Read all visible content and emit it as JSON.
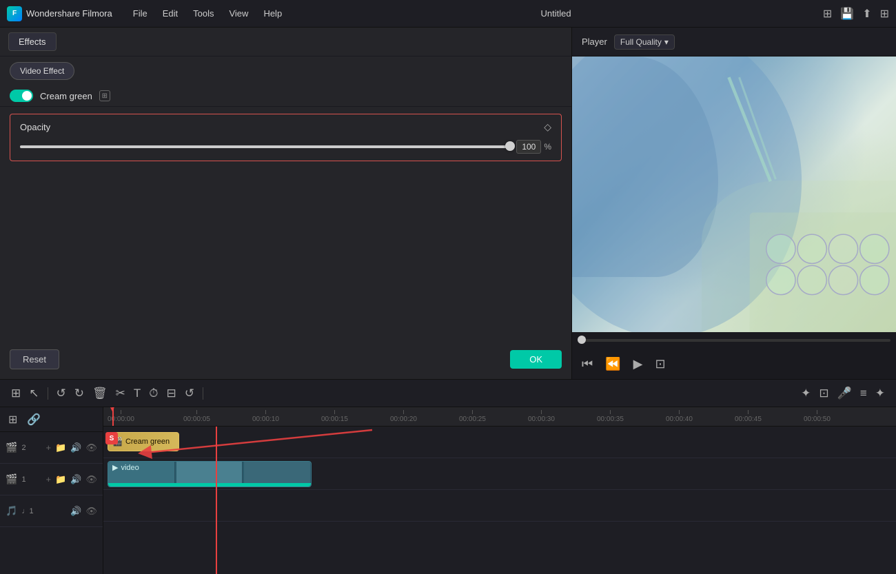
{
  "app": {
    "name": "Wondershare Filmora",
    "title": "Untitled"
  },
  "menu": {
    "items": [
      "File",
      "Edit",
      "Tools",
      "View",
      "Help"
    ]
  },
  "effects_panel": {
    "tab_label": "Effects",
    "video_effect_btn": "Video Effect",
    "toggle_label": "Cream green",
    "opacity_label": "Opacity",
    "opacity_value": "100",
    "percent": "%",
    "reset_btn": "Reset",
    "ok_btn": "OK"
  },
  "player": {
    "label": "Player",
    "quality_label": "Full Quality"
  },
  "timeline": {
    "tracks": [
      {
        "id": "track2",
        "type": "effect",
        "label": "2"
      },
      {
        "id": "track1",
        "type": "video",
        "label": "1"
      },
      {
        "id": "trackA1",
        "type": "audio",
        "label": "♩1"
      }
    ],
    "time_marks": [
      "00:00:00",
      "00:00:05",
      "00:00:10",
      "00:00:15",
      "00:00:20",
      "00:00:25",
      "00:00:30",
      "00:00:35",
      "00:00:40",
      "00:00:45",
      "00:00:50"
    ],
    "effect_clip_label": "Cream green",
    "video_clip_label": "video"
  }
}
